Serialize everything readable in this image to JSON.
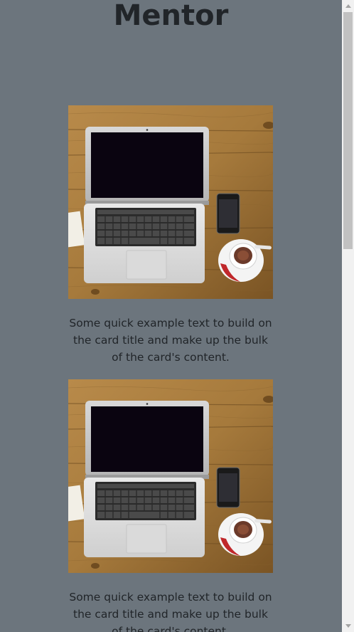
{
  "page": {
    "title": "Mentor"
  },
  "cards": [
    {
      "image": "laptop-desk-photo",
      "text": "Some quick example text to build on the card title and make up the bulk of the card's content."
    },
    {
      "image": "laptop-desk-photo",
      "text": "Some quick example text to build on the card title and make up the bulk of the card's content."
    }
  ],
  "colors": {
    "background": "#6c757d",
    "text": "#212529",
    "wood": "#a07537"
  }
}
